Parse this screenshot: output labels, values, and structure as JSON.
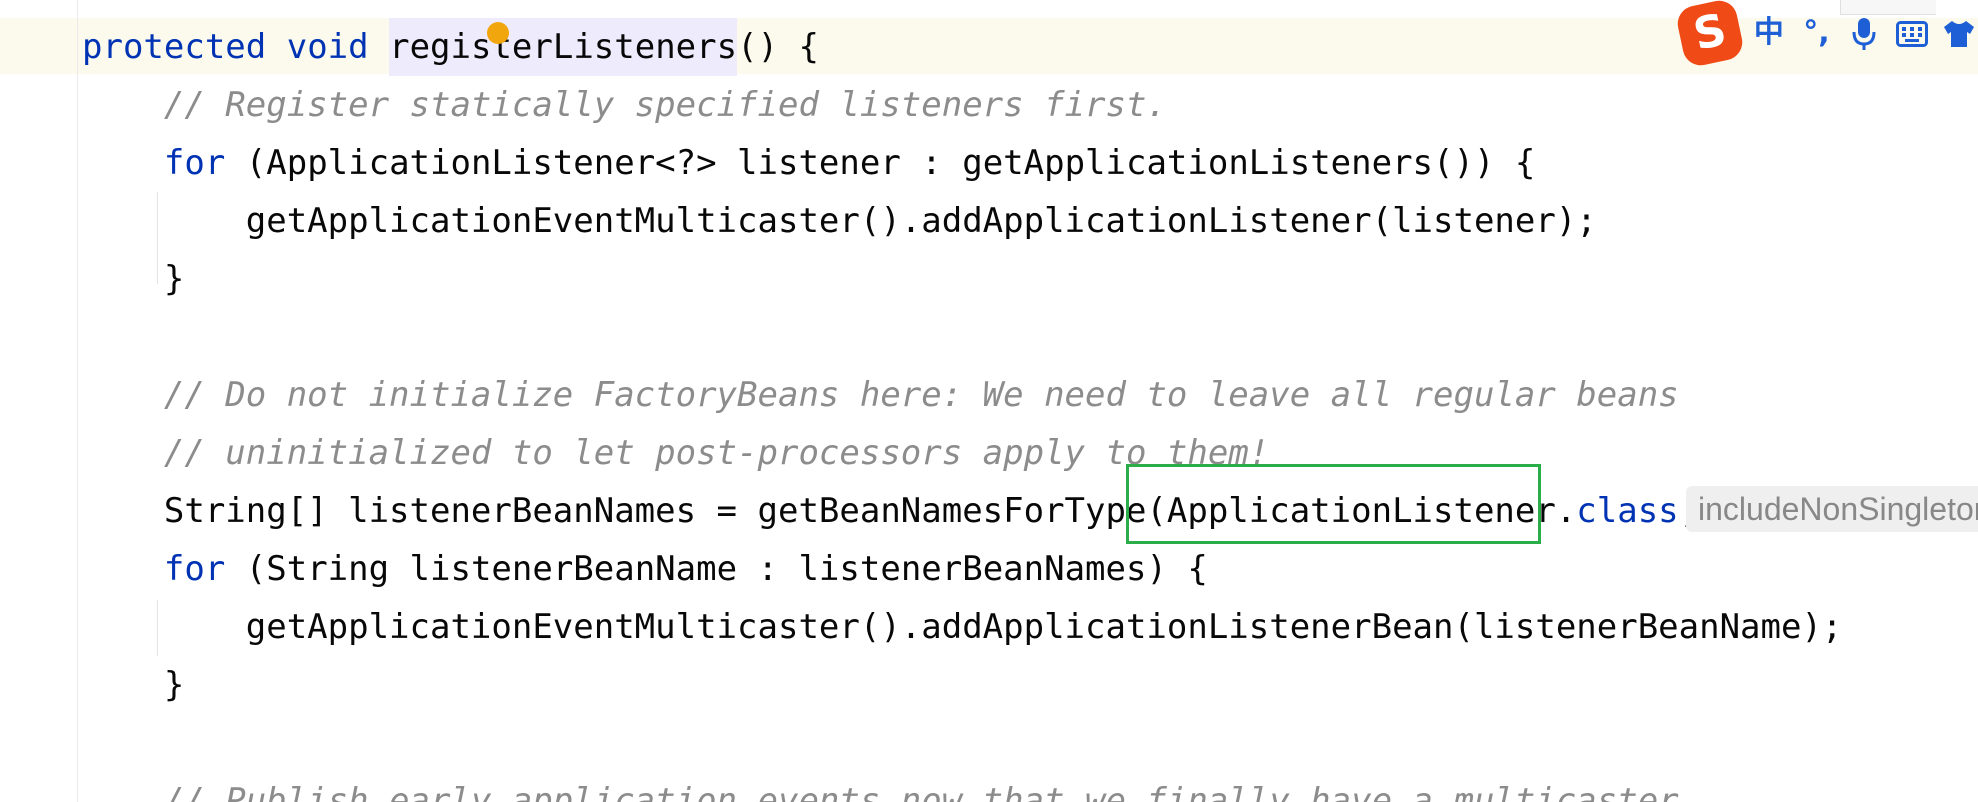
{
  "editor": {
    "lines": [
      {
        "parts": [
          {
            "t": "protected",
            "c": "kw"
          },
          {
            "t": " ",
            "c": "txt"
          },
          {
            "t": "void",
            "c": "kw"
          },
          {
            "t": " ",
            "c": "txt"
          },
          {
            "t": "registerListeners",
            "c": "txt",
            "hl": true
          },
          {
            "t": "() {",
            "c": "txt"
          }
        ]
      },
      {
        "parts": [
          {
            "t": "    // Register statically specified listeners first.",
            "c": "cm"
          }
        ]
      },
      {
        "parts": [
          {
            "t": "    ",
            "c": "txt"
          },
          {
            "t": "for",
            "c": "kw"
          },
          {
            "t": " (ApplicationListener<?> listener : getApplicationListeners()) {",
            "c": "txt"
          }
        ]
      },
      {
        "parts": [
          {
            "t": "        getApplicationEventMulticaster().addApplicationListener(listener);",
            "c": "txt"
          }
        ]
      },
      {
        "parts": [
          {
            "t": "    }",
            "c": "txt"
          }
        ]
      },
      {
        "parts": []
      },
      {
        "parts": [
          {
            "t": "    // Do not initialize FactoryBeans here: We need to leave all regular beans",
            "c": "cm"
          }
        ]
      },
      {
        "parts": [
          {
            "t": "    // uninitialized to let post-processors apply to them!",
            "c": "cm"
          }
        ]
      },
      {
        "parts": [
          {
            "t": "    String[] listenerBeanNames = getBeanNamesForType(ApplicationListener.",
            "c": "txt"
          },
          {
            "t": "class",
            "c": "kw"
          },
          {
            "t": ",",
            "c": "txt"
          }
        ]
      },
      {
        "parts": [
          {
            "t": "    ",
            "c": "txt"
          },
          {
            "t": "for",
            "c": "kw"
          },
          {
            "t": " (String listenerBeanName : listenerBeanNames) {",
            "c": "txt"
          }
        ]
      },
      {
        "parts": [
          {
            "t": "        getApplicationEventMulticaster().addApplicationListenerBean(listenerBeanName);",
            "c": "txt"
          }
        ]
      },
      {
        "parts": [
          {
            "t": "    }",
            "c": "txt"
          }
        ]
      },
      {
        "parts": []
      },
      {
        "parts": [
          {
            "t": "    // Publish early application events now that we finally have a multicaster...",
            "c": "cm"
          }
        ]
      }
    ],
    "param_hint": "includeNonSingletons:"
  },
  "ime_toolbar": {
    "logo": "S",
    "items": [
      {
        "label": "中",
        "icon": "chinese-mode-icon"
      },
      {
        "label": "°,",
        "icon": "punctuation-icon"
      },
      {
        "label": "",
        "icon": "microphone-icon"
      },
      {
        "label": "",
        "icon": "keyboard-icon"
      },
      {
        "label": "",
        "icon": "shirt-skin-icon"
      }
    ]
  },
  "colors": {
    "keyword": "#0033b3",
    "comment": "#8c8c8c",
    "text": "#080808",
    "highlight_box": "#2bad4a",
    "caret_dot": "#f2a60d",
    "ime_logo": "#f04a16",
    "ime_icons": "#1f5fd6"
  }
}
